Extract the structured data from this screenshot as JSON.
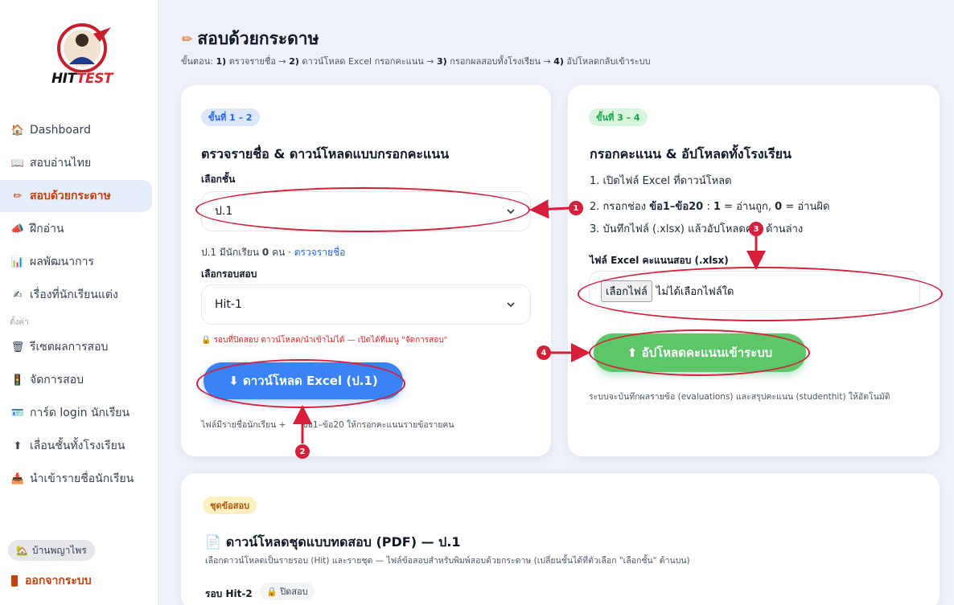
{
  "logo": {
    "text_a": "HIT",
    "text_b": "TEST"
  },
  "sidebar": {
    "items": [
      {
        "icon": "house-icon",
        "label": "Dashboard"
      },
      {
        "icon": "book-icon",
        "label": "สอบอ่านไทย"
      },
      {
        "icon": "pencil-icon",
        "label": "สอบด้วยกระดาษ",
        "active": true
      },
      {
        "icon": "megaphone-icon",
        "label": "ฝึกอ่าน"
      },
      {
        "icon": "bar-chart-icon",
        "label": "ผลพัฒนาการ"
      },
      {
        "icon": "writing-hand-icon",
        "label": "เรื่องที่นักเรียนแต่ง"
      }
    ],
    "section_label": "ตั้งค่า",
    "settings_items": [
      {
        "icon": "trash-icon",
        "label": "รีเซตผลการสอบ"
      },
      {
        "icon": "traffic-light-icon",
        "label": "จัดการสอบ"
      },
      {
        "icon": "id-card-icon",
        "label": "การ์ด login นักเรียน"
      },
      {
        "icon": "up-arrow-icon",
        "label": "เลื่อนชั้นทั้งโรงเรียน"
      },
      {
        "icon": "upload-icon",
        "label": "นำเข้ารายชื่อนักเรียน"
      }
    ],
    "home_chip": "บ้านพญาไพร",
    "logout": "ออกจากระบบ"
  },
  "header": {
    "title": "สอบด้วยกระดาษ",
    "steps_prefix": "ขั้นตอน:",
    "steps": [
      {
        "num": "1)",
        "text": "ตรวจรายชื่อ →"
      },
      {
        "num": "2)",
        "text": "ดาวน์โหลด Excel กรอกคะแนน →"
      },
      {
        "num": "3)",
        "text": "กรอกผลสอบทั้งโรงเรียน →"
      },
      {
        "num": "4)",
        "text": "อัปโหลดกลับเข้าระบบ"
      }
    ]
  },
  "card_left": {
    "pill": "ขั้นที่ 1 – 2",
    "title": "ตรวจรายชื่อ & ดาวน์โหลดแบบกรอกคะแนน",
    "class_label": "เลือกชั้น",
    "class_value": "ป.1",
    "student_info_prefix": "ป.1 มีนักเรียน",
    "student_count": "0",
    "student_info_suffix": "คน ·",
    "check_link": "ตรวจรายชื่อ",
    "round_label": "เลือกรอบสอบ",
    "round_value": "Hit-1",
    "warning": "🔒 รอบที่ปิดสอบ ดาวน์โหลด/นำเข้าไม่ได้ — เปิดได้ที่เมนู \"จัดการสอบ\"",
    "download_button": "⬇ ดาวน์โหลด Excel (ป.1)",
    "footnote_a": "ไฟล์มีรายชื่อนักเรียน +",
    "footnote_b": "ข้อ1–ข้อ20 ให้กรอกคะแนนรายข้อรายคน"
  },
  "card_right": {
    "pill": "ขั้นที่ 3 – 4",
    "title": "กรอกคะแนน & อัปโหลดทั้งโรงเรียน",
    "step1": "1. เปิดไฟล์ Excel ที่ดาวน์โหลด",
    "step2_a": "2. กรอกช่อง",
    "step2_b": "ข้อ1–ข้อ20",
    "step2_c": ":",
    "step2_d": "1",
    "step2_e": "= อ่านถูก,",
    "step2_f": "0",
    "step2_g": "= อ่านผิด",
    "step3_a": "3. บันทึกไฟล์ (.xlsx) แล้วอัปโหลดค",
    "step3_b": "ด้านล่าง",
    "file_label": "ไฟล์ Excel คะแนนสอบ (.xlsx)",
    "file_button": "เลือกไฟล์",
    "file_status": "ไม่ได้เลือกไฟล์ใด",
    "upload_button": "⬆ อัปโหลดคะแนนเข้าระบบ",
    "note": "ระบบจะบันทึกผลรายข้อ (evaluations) และสรุปคะแนน (studenthit) ให้อัตโนมัติ"
  },
  "card_bottom": {
    "pill": "ชุดข้อสอบ",
    "title": "ดาวน์โหลดชุดแบบทดสอบ (PDF) — ป.1",
    "desc": "เลือกดาวน์โหลดเป็นรายรอบ (Hit) และรายชุด — ไฟล์ข้อสอบสำหรับพิมพ์สอบด้วยกระดาษ (เปลี่ยนชั้นได้ที่ตัวเลือก \"เลือกชั้น\" ด้านบน)",
    "round_label": "รอบ Hit-2",
    "round_status": "🔒 ปิดสอบ"
  },
  "annotations": [
    "1",
    "2",
    "3",
    "4"
  ],
  "colors": {
    "accent": "#3b82f6",
    "annotation": "#d61f3a",
    "upload": "#5cc669",
    "active_text": "#c2410c"
  }
}
